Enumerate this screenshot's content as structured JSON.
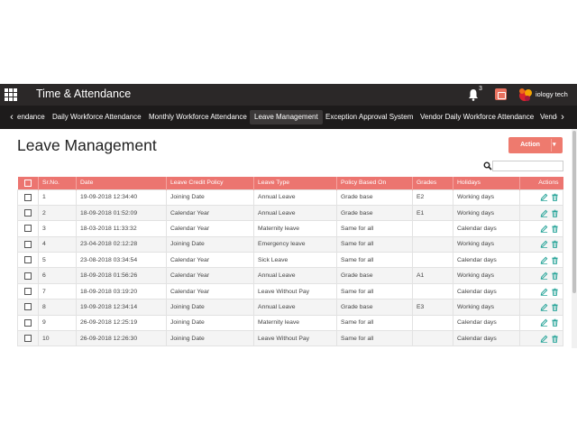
{
  "app": {
    "title": "Time & Attendance",
    "notification_count": "3",
    "logo_text": "iology tech"
  },
  "nav": {
    "items": [
      {
        "label": "endance"
      },
      {
        "label": "Daily Workforce Attendance"
      },
      {
        "label": "Monthly Workforce Attendance"
      },
      {
        "label": "Leave Management"
      },
      {
        "label": "Exception Approval System"
      },
      {
        "label": "Vendor Daily Workforce Attendance"
      },
      {
        "label": "Vendo"
      }
    ],
    "active": "Leave Management"
  },
  "page": {
    "title": "Leave Management",
    "action_label": "Action"
  },
  "search": {
    "value": "",
    "placeholder": ""
  },
  "table": {
    "headers": [
      "Sr.No.",
      "Date",
      "Leave Credit Policy",
      "Leave Type",
      "Policy Based On",
      "Grades",
      "Holidays",
      "Actions"
    ],
    "rows": [
      {
        "sr": "1",
        "date": "19-09-2018 12:34:40",
        "policy": "Joining Date",
        "type": "Annual Leave",
        "based_on": "Grade base",
        "grade": "E2",
        "holidays": "Working days"
      },
      {
        "sr": "2",
        "date": "18-09-2018 01:52:09",
        "policy": "Calendar Year",
        "type": "Annual Leave",
        "based_on": "Grade base",
        "grade": "E1",
        "holidays": "Working days"
      },
      {
        "sr": "3",
        "date": "18-03-2018 11:33:32",
        "policy": "Calendar Year",
        "type": "Maternity leave",
        "based_on": "Same for all",
        "grade": "",
        "holidays": "Calendar days"
      },
      {
        "sr": "4",
        "date": "23-04-2018 02:12:28",
        "policy": "Joining Date",
        "type": "Emergency leave",
        "based_on": "Same for all",
        "grade": "",
        "holidays": "Working days"
      },
      {
        "sr": "5",
        "date": "23-08-2018 03:34:54",
        "policy": "Calendar Year",
        "type": "Sick Leave",
        "based_on": "Same for all",
        "grade": "",
        "holidays": "Calendar days"
      },
      {
        "sr": "6",
        "date": "18-09-2018 01:56:26",
        "policy": "Calendar Year",
        "type": "Annual Leave",
        "based_on": "Grade base",
        "grade": "A1",
        "holidays": "Working days"
      },
      {
        "sr": "7",
        "date": "18-09-2018 03:19:20",
        "policy": "Calendar Year",
        "type": "Leave Without Pay",
        "based_on": "Same for all",
        "grade": "",
        "holidays": "Calendar days"
      },
      {
        "sr": "8",
        "date": "19-09-2018 12:34:14",
        "policy": "Joining Date",
        "type": "Annual Leave",
        "based_on": "Grade base",
        "grade": "E3",
        "holidays": "Working days"
      },
      {
        "sr": "9",
        "date": "26-09-2018 12:25:19",
        "policy": "Joining Date",
        "type": "Maternity leave",
        "based_on": "Same for all",
        "grade": "",
        "holidays": "Calendar days"
      },
      {
        "sr": "10",
        "date": "26-09-2018 12:26:30",
        "policy": "Joining Date",
        "type": "Leave Without Pay",
        "based_on": "Same for all",
        "grade": "",
        "holidays": "Calendar days"
      }
    ]
  },
  "icons": {
    "apps": "grid-icon",
    "notifications": "bell-icon",
    "calendar": "calendar-icon",
    "search": "search-icon",
    "edit": "pencil-icon",
    "delete": "trash-icon",
    "nav_prev": "chevron-left-icon",
    "nav_next": "chevron-right-icon"
  },
  "colors": {
    "header_bar": "#2b2828",
    "nav_bar": "#1d1b1b",
    "accent": "#ec7570",
    "edit_icon": "#2aa59a",
    "delete_icon": "#2aa59a"
  }
}
